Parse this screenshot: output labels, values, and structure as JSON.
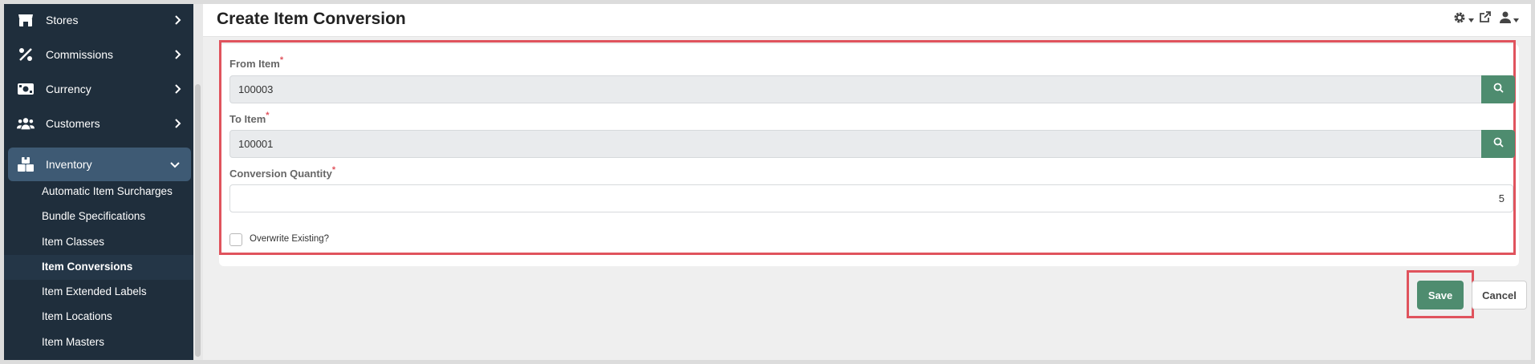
{
  "sidebar": {
    "items": [
      {
        "label": "Stores",
        "icon": "store-icon"
      },
      {
        "label": "Commissions",
        "icon": "percent-icon"
      },
      {
        "label": "Currency",
        "icon": "money-icon"
      },
      {
        "label": "Customers",
        "icon": "users-icon"
      },
      {
        "label": "Inventory",
        "icon": "boxes-icon"
      }
    ],
    "inventory_subitems": [
      "Automatic Item Surcharges",
      "Bundle Specifications",
      "Item Classes",
      "Item Conversions",
      "Item Extended Labels",
      "Item Locations",
      "Item Masters"
    ],
    "current_subitem": "Item Conversions"
  },
  "header": {
    "title": "Create Item Conversion"
  },
  "form": {
    "from_item": {
      "label": "From Item",
      "required_mark": "*",
      "value": "100003"
    },
    "to_item": {
      "label": "To Item",
      "required_mark": "*",
      "value": "100001"
    },
    "conversion_quantity": {
      "label": "Conversion Quantity",
      "required_mark": "*",
      "value": "5"
    },
    "overwrite": {
      "label": "Overwrite Existing?",
      "checked": false
    }
  },
  "actions": {
    "save_label": "Save",
    "cancel_label": "Cancel"
  },
  "colors": {
    "accent_green": "#4e8c6f",
    "highlight_red": "#e0535d",
    "sidebar_bg": "#1f2e3c",
    "sidebar_active": "#3e5a74"
  }
}
